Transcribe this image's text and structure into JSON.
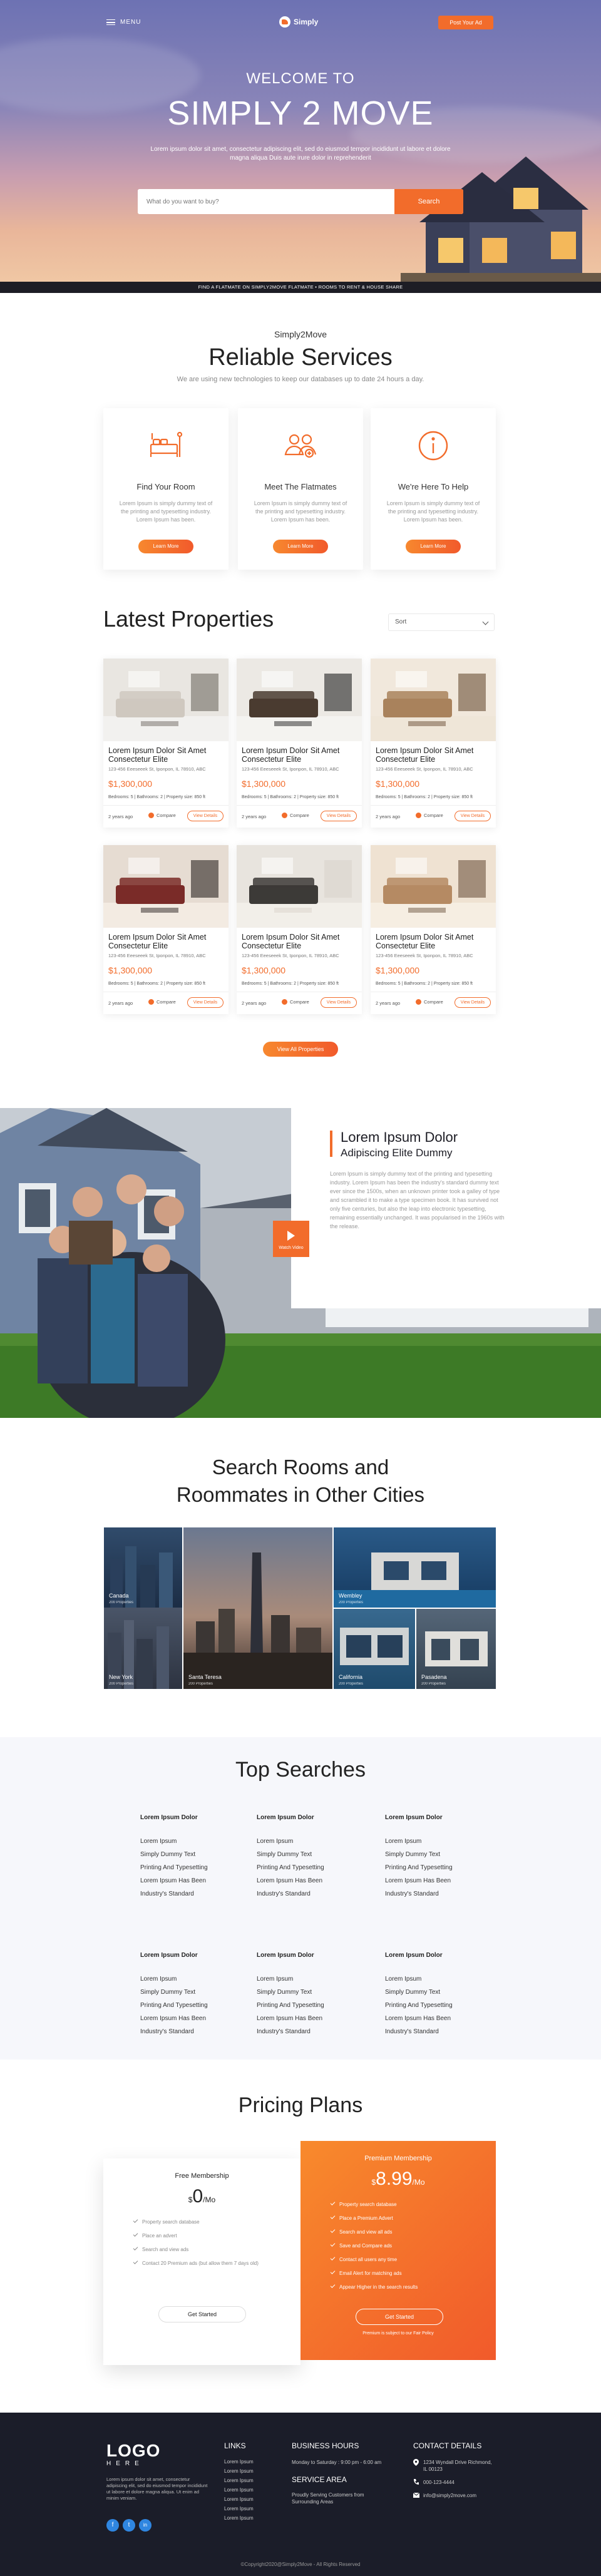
{
  "header": {
    "menu_label": "MENU",
    "logo_text": "Simply",
    "post_ad_label": "Post Your Ad"
  },
  "hero": {
    "welcome": "WELCOME TO",
    "title": "SIMPLY 2 MOVE",
    "subtitle": "Lorem ipsum dolor sit amet, consectetur adipiscing elit, sed do eiusmod tempor incididunt ut labore et dolore magna aliqua Duis aute irure dolor in reprehenderit",
    "search_placeholder": "What do you want to buy?",
    "search_button": "Search",
    "strip_text": "FIND A FLATMATE ON SIMPLY2MOVE FLATMATE • ROOMS TO RENT & HOUSE SHARE"
  },
  "services": {
    "eyebrow": "Simply2Move",
    "title": "Reliable Services",
    "subtitle": "We are using new technologies to keep our databases up to date 24 hours a day.",
    "cards": [
      {
        "icon": "bed-icon",
        "title": "Find Your Room",
        "text": "Lorem Ipsum is simply dummy text of the printing and typesetting industry. Lorem Ipsum has been.",
        "button": "Learn More"
      },
      {
        "icon": "flatmates-icon",
        "title": "Meet The Flatmates",
        "text": "Lorem Ipsum is simply dummy text of the printing and typesetting industry. Lorem Ipsum has been.",
        "button": "Learn More"
      },
      {
        "icon": "info-icon",
        "title": "We're Here To Help",
        "text": "Lorem Ipsum is simply dummy text of the printing and typesetting industry. Lorem Ipsum has been.",
        "button": "Learn More"
      }
    ]
  },
  "properties": {
    "title": "Latest Properties",
    "sort_label": "Sort",
    "view_all": "View All Properties",
    "items": [
      {
        "title": "Lorem Ipsum Dolor Sit Amet Consectetur Elite",
        "address": "123-456 Eeeseeek St, Iponpon, IL 78910, ABC",
        "price": "$1,300,000",
        "specs": "Bedrooms: 5  |  Bathrooms: 2  |  Property size: 850 ft",
        "ago": "2 years ago",
        "compare": "Compare",
        "view": "View Details"
      },
      {
        "title": "Lorem Ipsum Dolor Sit Amet Consectetur Elite",
        "address": "123-456 Eeeseeek St, Iponpon, IL 78910, ABC",
        "price": "$1,300,000",
        "specs": "Bedrooms: 5  |  Bathrooms: 2  |  Property size: 850 ft",
        "ago": "2 years ago",
        "compare": "Compare",
        "view": "View Details"
      },
      {
        "title": "Lorem Ipsum Dolor Sit Amet Consectetur Elite",
        "address": "123-456 Eeeseeek St, Iponpon, IL 78910, ABC",
        "price": "$1,300,000",
        "specs": "Bedrooms: 5  |  Bathrooms: 2  |  Property size: 850 ft",
        "ago": "2 years ago",
        "compare": "Compare",
        "view": "View Details"
      },
      {
        "title": "Lorem Ipsum Dolor Sit Amet Consectetur Elite",
        "address": "123-456 Eeeseeek St, Iponpon, IL 78910, ABC",
        "price": "$1,300,000",
        "specs": "Bedrooms: 5  |  Bathrooms: 2  |  Property size: 850 ft",
        "ago": "2 years ago",
        "compare": "Compare",
        "view": "View Details"
      },
      {
        "title": "Lorem Ipsum Dolor Sit Amet Consectetur Elite",
        "address": "123-456 Eeeseeek St, Iponpon, IL 78910, ABC",
        "price": "$1,300,000",
        "specs": "Bedrooms: 5  |  Bathrooms: 2  |  Property size: 850 ft",
        "ago": "2 years ago",
        "compare": "Compare",
        "view": "View Details"
      },
      {
        "title": "Lorem Ipsum Dolor Sit Amet Consectetur Elite",
        "address": "123-456 Eeeseeek St, Iponpon, IL 78910, ABC",
        "price": "$1,300,000",
        "specs": "Bedrooms: 5  |  Bathrooms: 2  |  Property size: 850 ft",
        "ago": "2 years ago",
        "compare": "Compare",
        "view": "View Details"
      }
    ]
  },
  "feature": {
    "title": "Lorem Ipsum Dolor",
    "subtitle": "Adipiscing Elite Dummy",
    "text": "Lorem Ipsum is simply dummy text of the printing and typesetting industry. Lorem Ipsum has been the industry's standard dummy text ever since the 1500s, when an unknown printer took a galley of type and scrambled it to make a type specimen book. It has survived not only five centuries, but also the leap into electronic typesetting, remaining essentially unchanged. It was popularised in the 1960s with the release.",
    "play_label": "Watch Video"
  },
  "cities": {
    "title_line1": "Search Rooms and",
    "title_line2": "Roommates in Other Cities",
    "items": [
      {
        "name": "Canada",
        "count": "200 Properties"
      },
      {
        "name": "New York",
        "count": "200 Properties"
      },
      {
        "name": "Santa Teresa",
        "count": "200 Properties"
      },
      {
        "name": "Wembley",
        "count": "200 Properties"
      },
      {
        "name": "California",
        "count": "200 Properties"
      },
      {
        "name": "Pasadena",
        "count": "200 Properties"
      }
    ]
  },
  "top_searches": {
    "title": "Top Searches",
    "columns": [
      {
        "heading": "Lorem Ipsum Dolor",
        "links": [
          "Lorem Ipsum",
          "Simply Dummy Text",
          "Printing And Typesetting",
          "Lorem Ipsum Has Been",
          "Industry's Standard"
        ]
      },
      {
        "heading": "Lorem Ipsum Dolor",
        "links": [
          "Lorem Ipsum",
          "Simply Dummy Text",
          "Printing And Typesetting",
          "Lorem Ipsum Has Been",
          "Industry's Standard"
        ]
      },
      {
        "heading": "Lorem Ipsum Dolor",
        "links": [
          "Lorem Ipsum",
          "Simply Dummy Text",
          "Printing And Typesetting",
          "Lorem Ipsum Has Been",
          "Industry's Standard"
        ]
      },
      {
        "heading": "Lorem Ipsum Dolor",
        "links": [
          "Lorem Ipsum",
          "Simply Dummy Text",
          "Printing And Typesetting",
          "Lorem Ipsum Has Been",
          "Industry's Standard"
        ]
      },
      {
        "heading": "Lorem Ipsum Dolor",
        "links": [
          "Lorem Ipsum",
          "Simply Dummy Text",
          "Printing And Typesetting",
          "Lorem Ipsum Has Been",
          "Industry's Standard"
        ]
      },
      {
        "heading": "Lorem Ipsum Dolor",
        "links": [
          "Lorem Ipsum",
          "Simply Dummy Text",
          "Printing And Typesetting",
          "Lorem Ipsum Has Been",
          "Industry's Standard"
        ]
      }
    ]
  },
  "pricing": {
    "title": "Pricing Plans",
    "free": {
      "name": "Free Membership",
      "currency": "$",
      "amount": "0",
      "period": "/Mo",
      "features": [
        "Property search database",
        "Place an advert",
        "Search and view ads",
        "Contact 20 Premium ads (but allow them 7 days old)"
      ],
      "button": "Get Started"
    },
    "premium": {
      "name": "Premium Membership",
      "currency": "$",
      "amount": "8.99",
      "period": "/Mo",
      "features": [
        "Property search database",
        "Place a Premium Advert",
        "Search and view all ads",
        "Save and Compare ads",
        "Contact all users any time",
        "Email Alert for matching ads",
        "Appear Higher in the search results"
      ],
      "button": "Get Started",
      "note": "Premium is subject to our Fair Policy"
    }
  },
  "footer": {
    "logo": "LOGO",
    "logo_sub": "HERE",
    "about": "Lorem ipsum dolor sit amet, consectetur adipiscing elit, sed do eiusmod tempor incididunt ut labore et dolore magna aliqua. Ut enim ad minim veniam.",
    "social": [
      "f",
      "t",
      "in"
    ],
    "links_heading": "LINKS",
    "links": [
      "Lorem Ipsum",
      "Lorem Ipsum",
      "Lorem Ipsum",
      "Lorem Ipsum",
      "Lorem Ipsum",
      "Lorem Ipsum",
      "Lorem Ipsum"
    ],
    "hours_heading": "BUSINESS HOURS",
    "hours": "Monday to Saturday : 9:00 pm - 6:00 am",
    "area_heading": "SERVICE AREA",
    "area": "Proudly Serving Customers from Surrounding Areas",
    "contact_heading": "CONTACT DETAILS",
    "address": "1234 Wyndall Drive Richmond, IL 00123",
    "phone": "000-123-4444",
    "email": "info@simply2move.com",
    "copyright": "©Copyright2020@Simply2Move - All Rights Reserved"
  },
  "colors": {
    "accent": "#f26c2b",
    "dark": "#1b1d29",
    "light_bg": "#f6f7fb"
  }
}
